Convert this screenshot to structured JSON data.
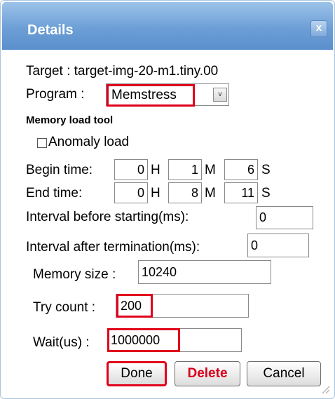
{
  "dialog": {
    "title": "Details",
    "close_glyph": "x"
  },
  "target": {
    "label": "Target : target-img-20-m1.tiny.00"
  },
  "program": {
    "label": "Program :",
    "selected": "Memstress",
    "arrow_glyph": "v"
  },
  "section": {
    "title": "Memory load tool"
  },
  "anomaly": {
    "label": "Anomaly load",
    "checked": false
  },
  "begin_time": {
    "label": "Begin time:",
    "hours": "0",
    "h_unit": "H",
    "minutes": "1",
    "m_unit": "M",
    "seconds": "6",
    "s_unit": "S"
  },
  "end_time": {
    "label": "End time:",
    "hours": "0",
    "h_unit": "H",
    "minutes": "8",
    "m_unit": "M",
    "seconds": "11",
    "s_unit": "S"
  },
  "interval_start": {
    "label": "Interval before starting(ms):",
    "value": "0"
  },
  "interval_end": {
    "label": "Interval after termination(ms):",
    "value": "0"
  },
  "memory_size": {
    "label": "Memory size :",
    "value": "10240"
  },
  "try_count": {
    "label": "Try count :",
    "value": "200"
  },
  "wait": {
    "label": "Wait(us) :",
    "value": "1000000"
  },
  "buttons": {
    "done": "Done",
    "delete": "Delete",
    "cancel": "Cancel"
  },
  "colors": {
    "title_bar": "#6d9fd6",
    "highlight": "#e0001b",
    "delete_text": "#d9001b"
  }
}
